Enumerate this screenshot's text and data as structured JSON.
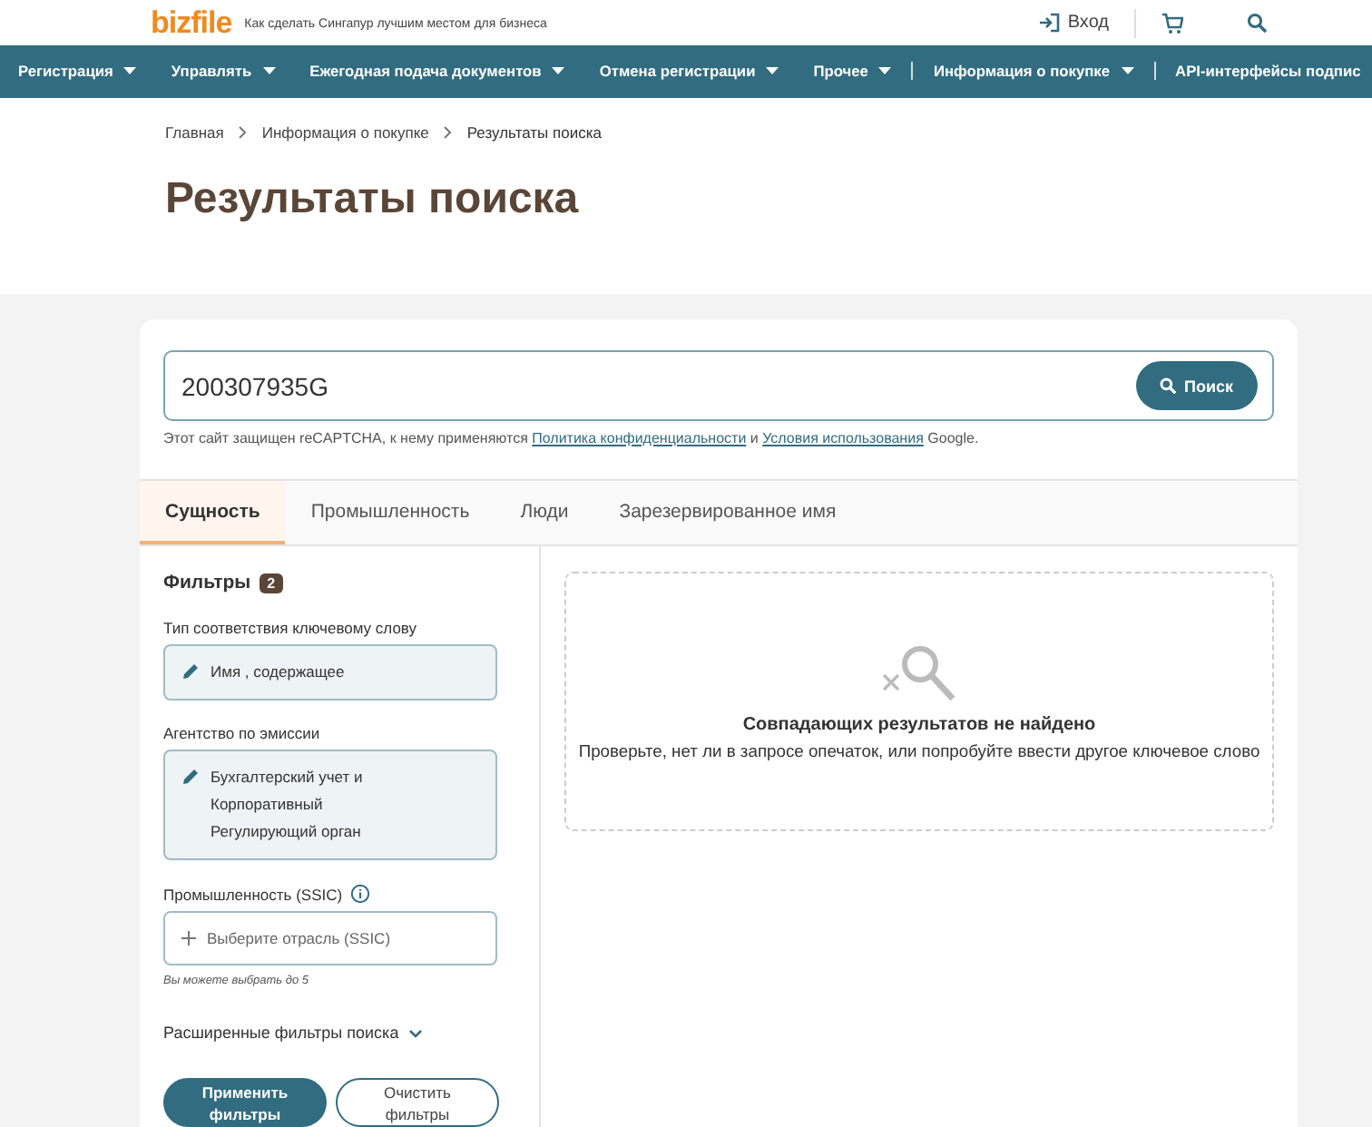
{
  "header": {
    "logo": "bizfile",
    "tagline": "Как сделать Сингапур лучшим местом для бизнеса",
    "login": "Вход"
  },
  "nav": [
    {
      "label": "Регистрация",
      "dropdown": true,
      "divider": false
    },
    {
      "label": "Управлять",
      "dropdown": true,
      "divider": false
    },
    {
      "label": "Ежегодная подача документов",
      "dropdown": true,
      "divider": false
    },
    {
      "label": "Отмена регистрации",
      "dropdown": true,
      "divider": false
    },
    {
      "label": "Прочее",
      "dropdown": true,
      "divider": false
    },
    {
      "label": "Информация о покупке",
      "dropdown": true,
      "divider": true
    },
    {
      "label": "API-интерфейсы подпис",
      "dropdown": false,
      "divider": true
    }
  ],
  "breadcrumb": [
    "Главная",
    "Информация о покупке",
    "Результаты поиска"
  ],
  "title": "Результаты поиска",
  "search": {
    "value": "200307935G",
    "button": "Поиск",
    "notice_before": "Этот сайт защищен reCAPTCHA, к нему применяются",
    "privacy_link": "Политика конфиденциальности",
    "notice_and": "и",
    "terms_link": "Условия использования",
    "notice_after": "Google."
  },
  "tabs": [
    {
      "label": "Сущность",
      "selected": true
    },
    {
      "label": "Промышленность",
      "selected": false
    },
    {
      "label": "Люди",
      "selected": false
    },
    {
      "label": "Зарезервированное имя",
      "selected": false
    }
  ],
  "filters": {
    "title": "Фильтры",
    "count": "2",
    "groups": [
      {
        "kind": "chosen",
        "label": "Тип соответствия ключевому слову",
        "value": "Имя , содержащее"
      },
      {
        "kind": "chosen",
        "label": "Агентство по эмиссии",
        "value": "Бухгалтерский учет и Корпоративный Регулирующий орган"
      },
      {
        "kind": "picker",
        "label": "Промышленность (SSIC)",
        "placeholder": "Выберите отрасль (SSIC)",
        "hint": "Вы можете выбрать до 5"
      }
    ],
    "advanced": "Расширенные фильтры поиска",
    "apply": "Применить фильтры",
    "clear": "Очистить фильтры"
  },
  "empty": {
    "title": "Совпадающих результатов не найдено",
    "message": "Проверьте, нет ли в запросе опечаток, или попробуйте ввести другое ключевое слово"
  }
}
